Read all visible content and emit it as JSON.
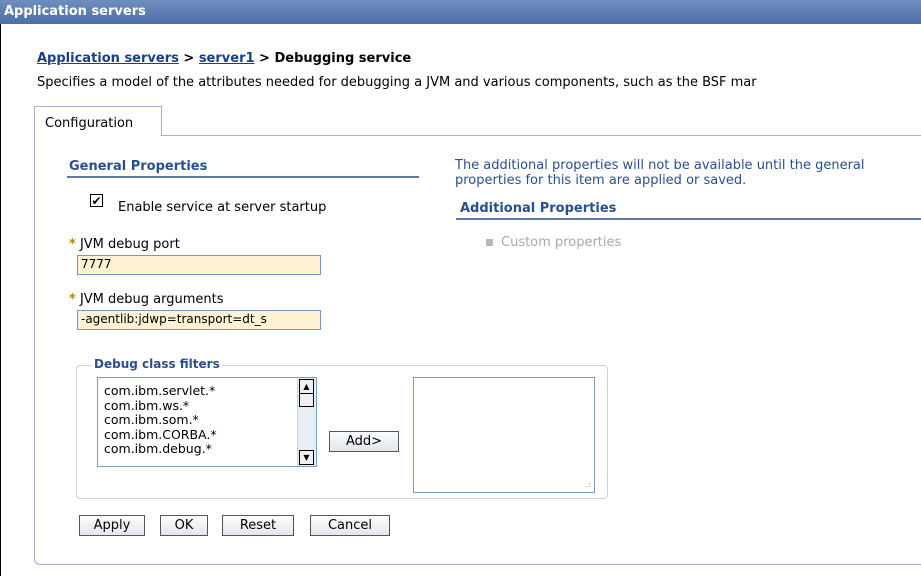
{
  "window": {
    "title": "Application servers"
  },
  "breadcrumb": {
    "root": "Application servers",
    "sep1": " > ",
    "server": "server1",
    "sep2": " > ",
    "current": "Debugging service"
  },
  "description": "Specifies a model of the attributes needed for debugging a JVM and various components, such as the BSF mar",
  "tabs": {
    "configuration": "Configuration"
  },
  "general": {
    "title": "General Properties",
    "enable_label": "Enable service at server startup",
    "enable_checked": true,
    "required_mark": "*",
    "port_label": "JVM debug port",
    "port_value": "7777",
    "args_label": "JVM debug arguments",
    "args_value": "-agentlib:jdwp=transport=dt_s"
  },
  "filters": {
    "legend": "Debug class filters",
    "items": [
      "com.ibm.servlet.*",
      "com.ibm.ws.*",
      "com.ibm.som.*",
      "com.ibm.CORBA.*",
      "com.ibm.debug.*"
    ],
    "add_label": "Add>"
  },
  "buttons": {
    "apply": "Apply",
    "ok": "OK",
    "reset": "Reset",
    "cancel": "Cancel"
  },
  "additional": {
    "note": "The additional properties will not be available until the general properties for this item are applied or saved.",
    "title": "Additional Properties",
    "custom": "Custom properties"
  }
}
